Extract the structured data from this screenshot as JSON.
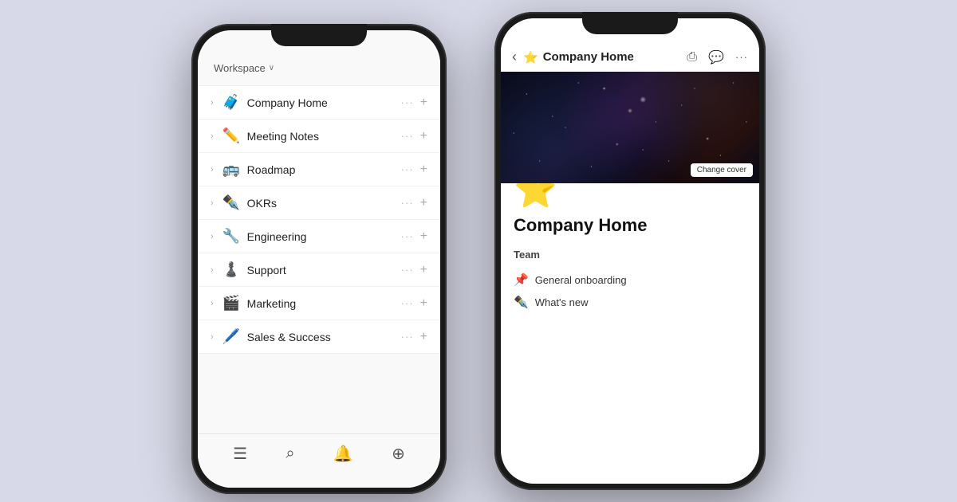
{
  "background": "#d8d9e8",
  "left_phone": {
    "workspace_label": "Workspace",
    "workspace_chevron": "∨",
    "nav_items": [
      {
        "id": "company-home",
        "emoji": "🧳",
        "label": "Company Home"
      },
      {
        "id": "meeting-notes",
        "emoji": "✏️",
        "label": "Meeting Notes"
      },
      {
        "id": "roadmap",
        "emoji": "🚌",
        "label": "Roadmap"
      },
      {
        "id": "okrs",
        "emoji": "✒️",
        "label": "OKRs"
      },
      {
        "id": "engineering",
        "emoji": "🔧",
        "label": "Engineering"
      },
      {
        "id": "support",
        "emoji": "♟️",
        "label": "Support"
      },
      {
        "id": "marketing",
        "emoji": "🎬",
        "label": "Marketing"
      },
      {
        "id": "sales",
        "emoji": "🖊️",
        "label": "Sales & Success"
      }
    ],
    "toolbar": {
      "icons": [
        "≡",
        "🔍",
        "🔔",
        "⊕"
      ]
    }
  },
  "right_phone": {
    "header": {
      "back_icon": "‹",
      "star_emoji": "⭐",
      "title": "Company Home",
      "share_icon": "⎙",
      "comment_icon": "💬",
      "more_icon": "···"
    },
    "cover": {
      "change_cover_label": "Change cover"
    },
    "page_emoji": "⭐",
    "page_title": "Company Home",
    "section_title": "Team",
    "sub_items": [
      {
        "emoji": "📌",
        "label": "General onboarding"
      },
      {
        "emoji": "✒️",
        "label": "What's new"
      }
    ]
  }
}
